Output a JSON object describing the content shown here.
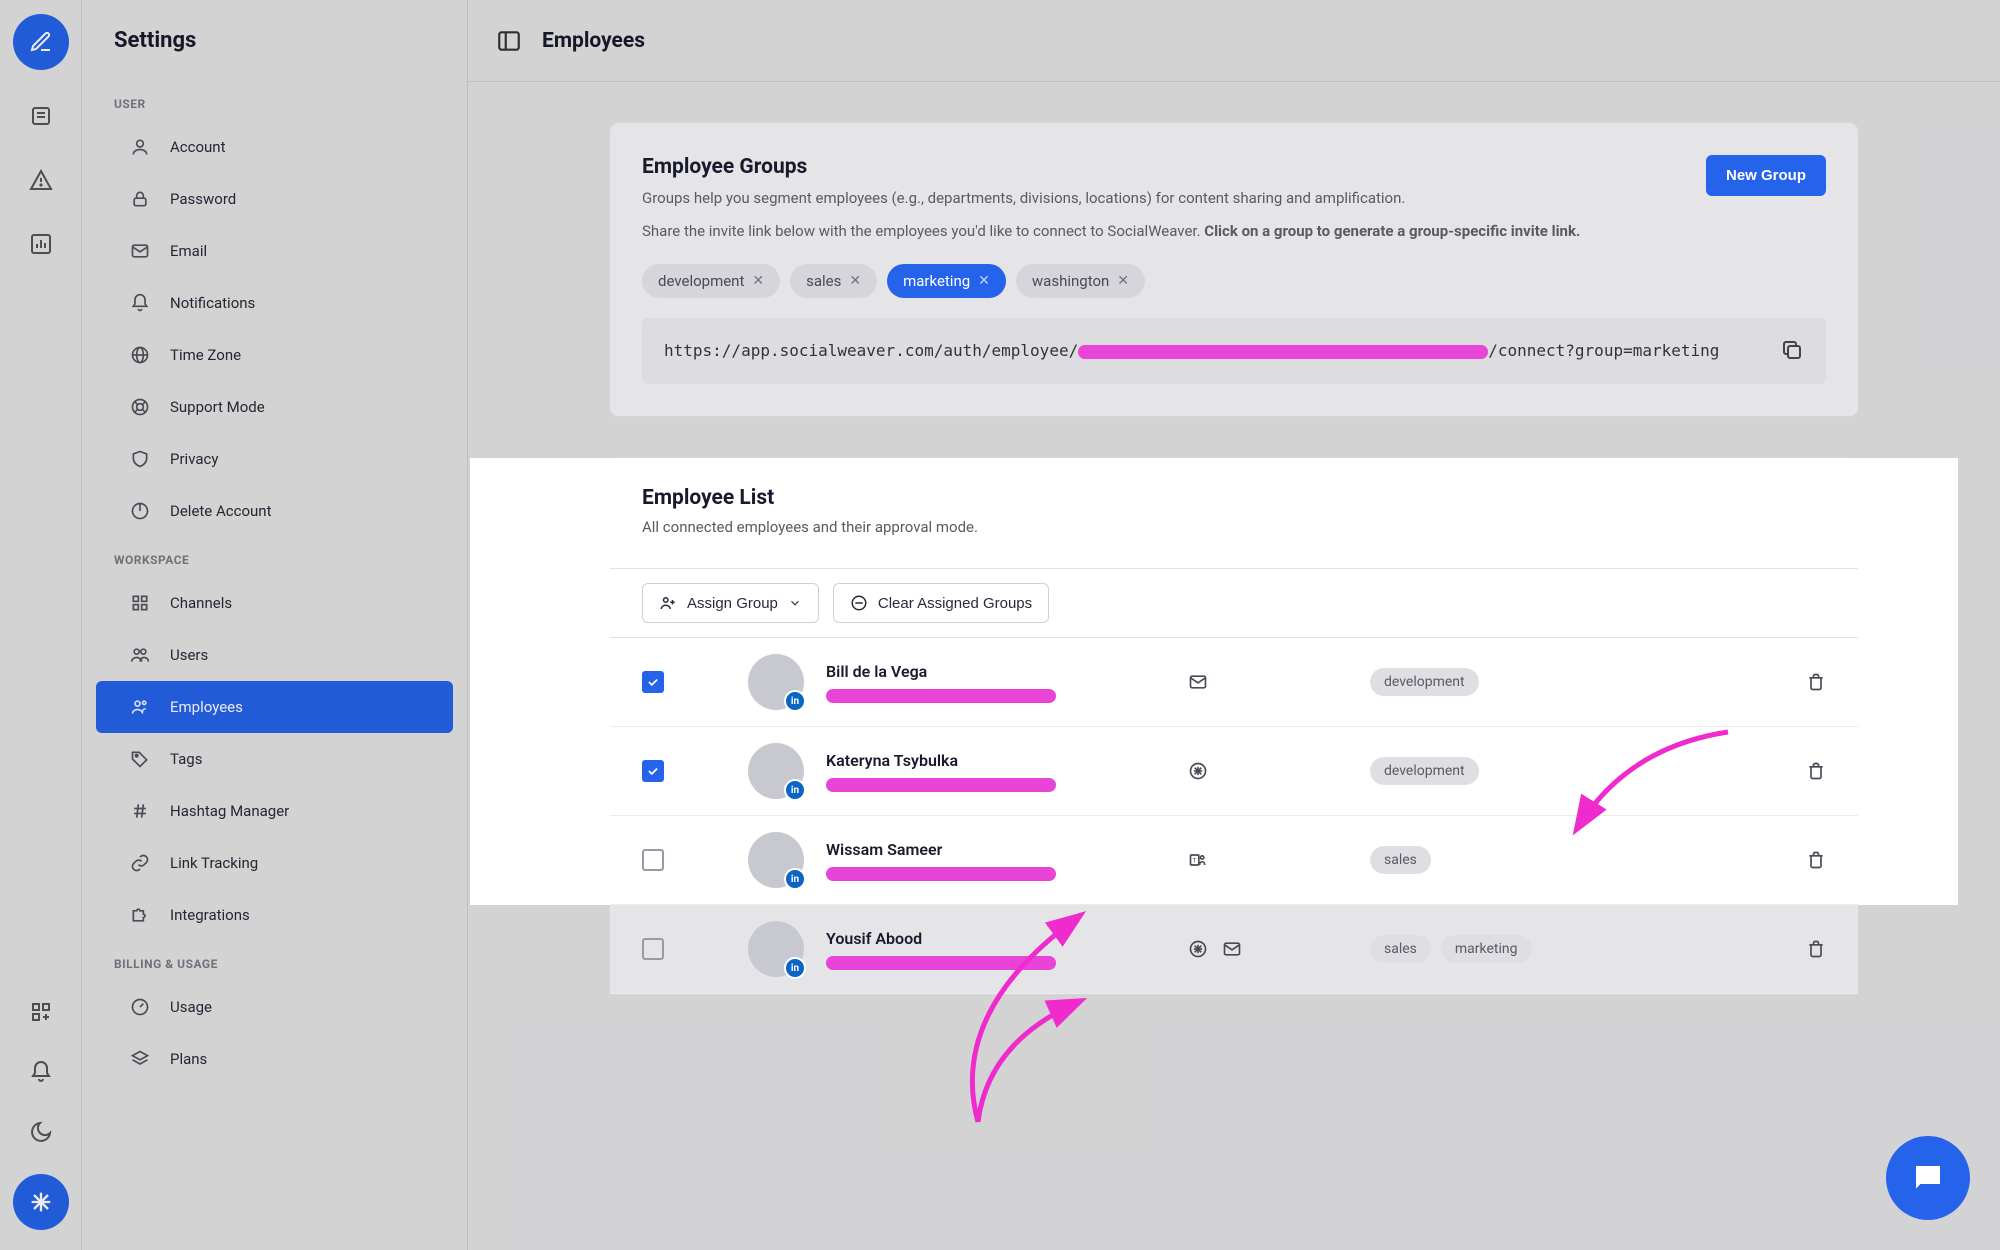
{
  "sidebar": {
    "title": "Settings",
    "sections": [
      {
        "label": "USER",
        "items": [
          {
            "id": "account",
            "label": "Account",
            "icon": "user"
          },
          {
            "id": "password",
            "label": "Password",
            "icon": "lock"
          },
          {
            "id": "email",
            "label": "Email",
            "icon": "mail"
          },
          {
            "id": "notifications",
            "label": "Notifications",
            "icon": "bell"
          },
          {
            "id": "timezone",
            "label": "Time Zone",
            "icon": "globe"
          },
          {
            "id": "support",
            "label": "Support Mode",
            "icon": "lifebuoy"
          },
          {
            "id": "privacy",
            "label": "Privacy",
            "icon": "shield"
          },
          {
            "id": "delete",
            "label": "Delete Account",
            "icon": "power"
          }
        ]
      },
      {
        "label": "WORKSPACE",
        "items": [
          {
            "id": "channels",
            "label": "Channels",
            "icon": "grid"
          },
          {
            "id": "users",
            "label": "Users",
            "icon": "users"
          },
          {
            "id": "employees",
            "label": "Employees",
            "icon": "employees",
            "active": true
          },
          {
            "id": "tags",
            "label": "Tags",
            "icon": "tag"
          },
          {
            "id": "hashtag",
            "label": "Hashtag Manager",
            "icon": "hash"
          },
          {
            "id": "linktrack",
            "label": "Link Tracking",
            "icon": "link"
          },
          {
            "id": "integrations",
            "label": "Integrations",
            "icon": "puzzle"
          }
        ]
      },
      {
        "label": "BILLING & USAGE",
        "items": [
          {
            "id": "usage",
            "label": "Usage",
            "icon": "gauge"
          },
          {
            "id": "plans",
            "label": "Plans",
            "icon": "layers"
          }
        ]
      }
    ]
  },
  "topbar": {
    "title": "Employees"
  },
  "groups_card": {
    "title": "Employee Groups",
    "desc1": "Groups help you segment employees (e.g., departments, divisions, locations) for content sharing and amplification.",
    "desc2a": "Share the invite link below with the employees you'd like to connect to SocialWeaver. ",
    "desc2b": "Click on a group to generate a group-specific invite link.",
    "new_group_btn": "New Group",
    "chips": [
      {
        "label": "development",
        "active": false
      },
      {
        "label": "sales",
        "active": false
      },
      {
        "label": "marketing",
        "active": true
      },
      {
        "label": "washington",
        "active": false
      }
    ],
    "invite_link_prefix": "https://app.socialweaver.com/auth/employee/",
    "invite_link_suffix": "/connect?group=marketing"
  },
  "list_card": {
    "title": "Employee List",
    "subtitle": "All connected employees and their approval mode.",
    "assign_btn": "Assign Group",
    "clear_btn": "Clear Assigned Groups",
    "rows": [
      {
        "checked": true,
        "name": "Bill de la Vega",
        "icons": [
          "mail"
        ],
        "tags": [
          "development"
        ]
      },
      {
        "checked": true,
        "name": "Kateryna Tsybulka",
        "icons": [
          "slack"
        ],
        "tags": [
          "development"
        ]
      },
      {
        "checked": false,
        "name": "Wissam Sameer",
        "icons": [
          "teams"
        ],
        "tags": [
          "sales"
        ]
      },
      {
        "checked": false,
        "name": "Yousif Abood",
        "icons": [
          "slack",
          "mail"
        ],
        "tags": [
          "sales",
          "marketing"
        ],
        "dim": true
      }
    ]
  }
}
